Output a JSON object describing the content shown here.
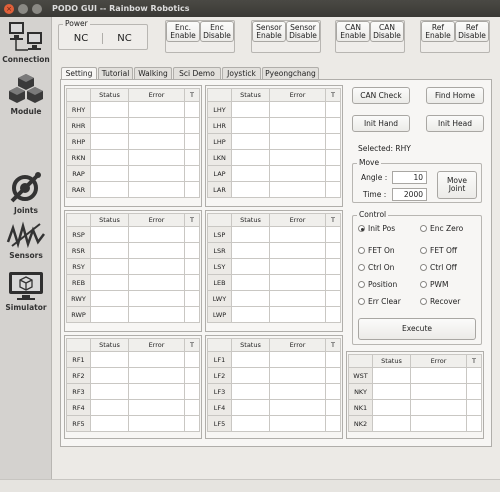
{
  "window": {
    "title": "PODO GUI -- Rainbow Robotics"
  },
  "sidebar": {
    "items": [
      {
        "label": "Connection",
        "icon": "computers-icon"
      },
      {
        "label": "Module",
        "icon": "cubes-icon"
      },
      {
        "label": "Joints",
        "icon": "joint-icon"
      },
      {
        "label": "Sensors",
        "icon": "sensor-wave-icon"
      },
      {
        "label": "Simulator",
        "icon": "monitor-cube-icon"
      }
    ]
  },
  "power": {
    "label": "Power",
    "left": "NC",
    "right": "NC"
  },
  "toggles": [
    {
      "enable": "Enc.\nEnable",
      "disable": "Enc\nDisable"
    },
    {
      "enable": "Sensor\nEnable",
      "disable": "Sensor\nDisable"
    },
    {
      "enable": "CAN\nEnable",
      "disable": "CAN\nDisable"
    },
    {
      "enable": "Ref\nEnable",
      "disable": "Ref\nDisable"
    }
  ],
  "tabs": [
    "Setting",
    "Tutorial",
    "Walking",
    "Sci Demo",
    "Joystick",
    "Pyeongchang"
  ],
  "table_headers": {
    "status": "Status",
    "error": "Error",
    "t": "T"
  },
  "tables": [
    {
      "rows": [
        "RHY",
        "RHR",
        "RHP",
        "RKN",
        "RAP",
        "RAR"
      ]
    },
    {
      "rows": [
        "LHY",
        "LHR",
        "LHP",
        "LKN",
        "LAP",
        "LAR"
      ]
    },
    {
      "rows": [
        "RSP",
        "RSR",
        "RSY",
        "REB",
        "RWY",
        "RWP"
      ]
    },
    {
      "rows": [
        "LSP",
        "LSR",
        "LSY",
        "LEB",
        "LWY",
        "LWP"
      ]
    },
    {
      "rows": [
        "RF1",
        "RF2",
        "RF3",
        "RF4",
        "RF5"
      ]
    },
    {
      "rows": [
        "LF1",
        "LF2",
        "LF3",
        "LF4",
        "LF5"
      ]
    },
    {
      "rows": [
        "WST",
        "NKY",
        "NK1",
        "NK2"
      ]
    }
  ],
  "buttons": {
    "can_check": "CAN Check",
    "find_home": "Find Home",
    "init_hand": "Init Hand",
    "init_head": "Init Head",
    "move_joint": "Move\nJoint",
    "execute": "Execute"
  },
  "selected": "Selected: RHY",
  "move": {
    "label": "Move",
    "angle_label": "Angle :",
    "angle_value": "10",
    "time_label": "Time :",
    "time_value": "2000"
  },
  "control": {
    "label": "Control",
    "options": [
      "Init Pos",
      "Enc Zero",
      "FET On",
      "FET Off",
      "Ctrl On",
      "Ctrl Off",
      "Position",
      "PWM",
      "Err Clear",
      "Recover"
    ],
    "selected": "Init Pos"
  }
}
